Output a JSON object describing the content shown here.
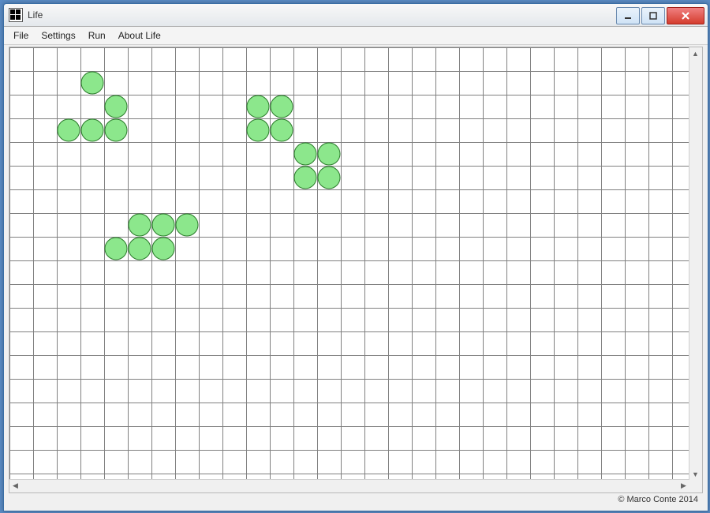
{
  "window": {
    "title": "Life"
  },
  "menu": {
    "file": "File",
    "settings": "Settings",
    "run": "Run",
    "about": "About Life"
  },
  "status": {
    "copyright": "© Marco Conte 2014"
  },
  "grid": {
    "cell_size": 30,
    "cols": 30,
    "rows": 19,
    "live_cells": [
      [
        3,
        1
      ],
      [
        4,
        2
      ],
      [
        2,
        3
      ],
      [
        3,
        3
      ],
      [
        4,
        3
      ],
      [
        10,
        2
      ],
      [
        11,
        2
      ],
      [
        10,
        3
      ],
      [
        11,
        3
      ],
      [
        12,
        4
      ],
      [
        13,
        4
      ],
      [
        12,
        5
      ],
      [
        13,
        5
      ],
      [
        5,
        7
      ],
      [
        6,
        7
      ],
      [
        7,
        7
      ],
      [
        4,
        8
      ],
      [
        5,
        8
      ],
      [
        6,
        8
      ]
    ],
    "cell_color": "#8ce78c",
    "cell_stroke": "#2a7a2a",
    "grid_color": "#808080"
  }
}
